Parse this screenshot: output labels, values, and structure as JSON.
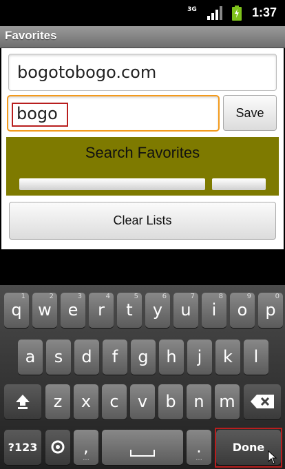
{
  "status_bar": {
    "network": "3G",
    "time": "1:37"
  },
  "title": "Favorites",
  "url_field": {
    "value": "bogotobogo.com"
  },
  "search_field": {
    "value": "bogo"
  },
  "save_button": "Save",
  "search_button": "Search Favorites",
  "clear_button": "Clear Lists",
  "keyboard": {
    "row1": [
      {
        "k": "q",
        "n": "1"
      },
      {
        "k": "w",
        "n": "2"
      },
      {
        "k": "e",
        "n": "3"
      },
      {
        "k": "r",
        "n": "4"
      },
      {
        "k": "t",
        "n": "5"
      },
      {
        "k": "y",
        "n": "6"
      },
      {
        "k": "u",
        "n": "7"
      },
      {
        "k": "i",
        "n": "8"
      },
      {
        "k": "o",
        "n": "9"
      },
      {
        "k": "p",
        "n": "0"
      }
    ],
    "row2": [
      "a",
      "s",
      "d",
      "f",
      "g",
      "h",
      "j",
      "k",
      "l"
    ],
    "row3": [
      "z",
      "x",
      "c",
      "v",
      "b",
      "n",
      "m"
    ],
    "symbols": "?123",
    "comma": ",",
    "period": ".",
    "done": "Done"
  },
  "colors": {
    "accent": "#f39a1c",
    "highlight": "#b81e1e",
    "panel": "#7e7a00"
  }
}
